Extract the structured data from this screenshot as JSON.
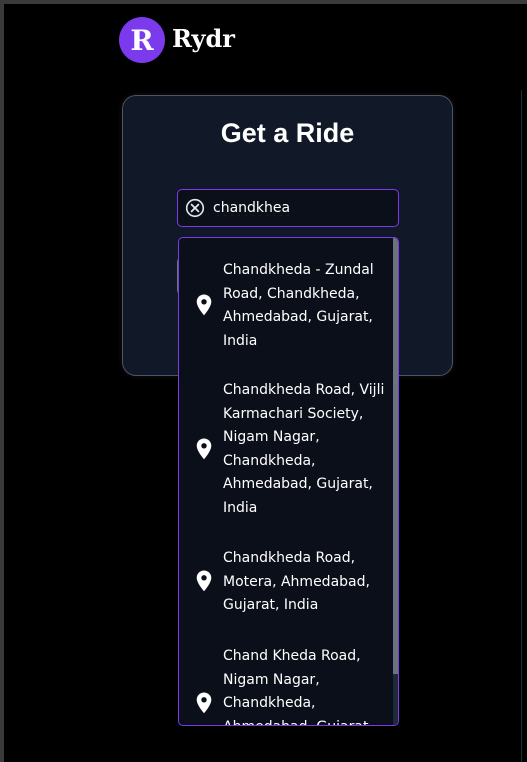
{
  "brand": {
    "logo_letter": "R",
    "name": "Rydr",
    "logo_color": "#7c3aed"
  },
  "card": {
    "title": "Get a Ride"
  },
  "search": {
    "value": "chandkhea",
    "icon": "cancel-icon"
  },
  "suggestions": [
    {
      "text": "Chandkheda - Zundal Road, Chandkheda, Ahmedabad, Gujarat, India",
      "icon": "map-pin-icon"
    },
    {
      "text": "Chandkheda Road, Vijli Karmachari Society, Nigam Nagar, Chandkheda, Ahmedabad, Gujarat, India",
      "icon": "map-pin-icon"
    },
    {
      "text": "Chandkheda Road, Motera, Ahmedabad, Gujarat, India",
      "icon": "map-pin-icon"
    },
    {
      "text": "Chand Kheda Road, Nigam Nagar, Chandkheda, Ahmedabad, Gujarat, India",
      "icon": "map-pin-icon"
    }
  ],
  "colors": {
    "accent": "#7c3aed",
    "card_bg": "#111827",
    "page_bg": "#000000"
  }
}
